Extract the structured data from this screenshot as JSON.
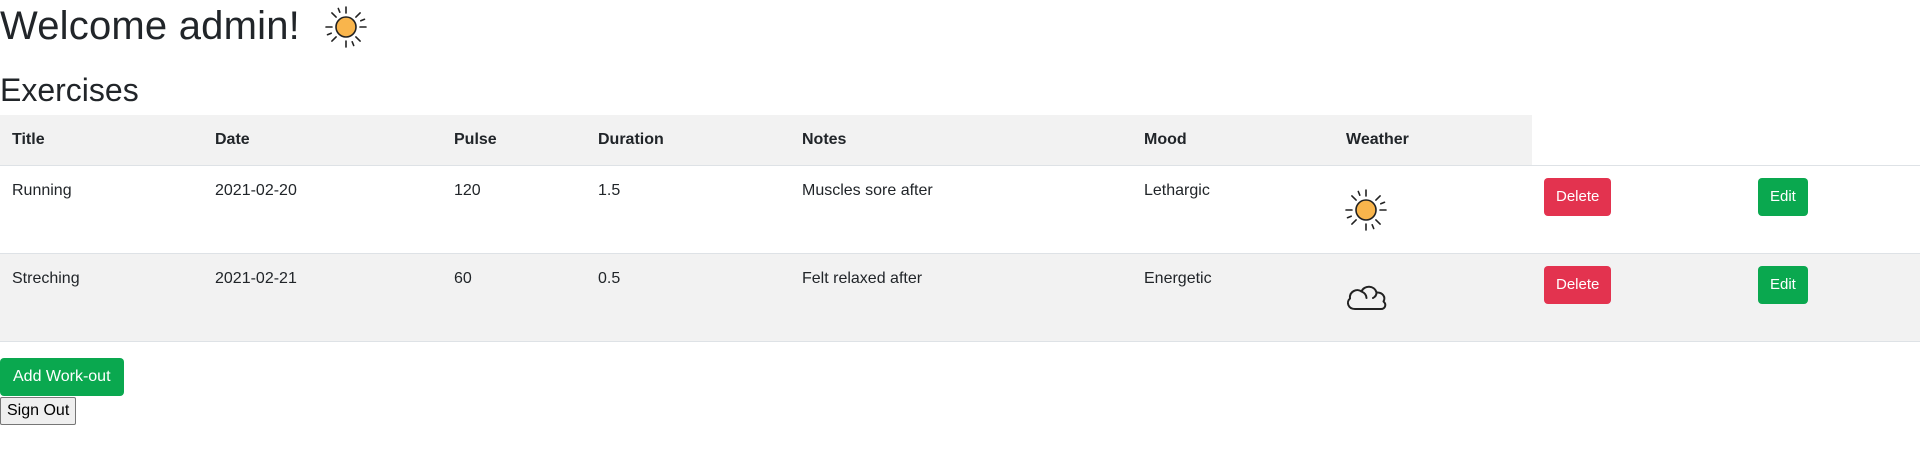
{
  "header": {
    "welcome": "Welcome admin!",
    "weather_icon": "sun-icon"
  },
  "section": {
    "title": "Exercises"
  },
  "table": {
    "columns": [
      "Title",
      "Date",
      "Pulse",
      "Duration",
      "Notes",
      "Mood",
      "Weather"
    ],
    "rows": [
      {
        "title": "Running",
        "date": "2021-02-20",
        "pulse": "120",
        "duration": "1.5",
        "notes": "Muscles sore after",
        "mood": "Lethargic",
        "weather": "sun-icon",
        "delete_label": "Delete",
        "edit_label": "Edit"
      },
      {
        "title": "Streching",
        "date": "2021-02-21",
        "pulse": "60",
        "duration": "0.5",
        "notes": "Felt relaxed after",
        "mood": "Energetic",
        "weather": "cloud-icon",
        "delete_label": "Delete",
        "edit_label": "Edit"
      }
    ]
  },
  "actions": {
    "add_label": "Add Work-out",
    "signout_label": "Sign Out"
  },
  "colors": {
    "delete": "#e3334f",
    "edit": "#0aa84f",
    "add": "#0aa84f",
    "row_stripe": "#f2f2f2",
    "sun_fill": "#f9b54c"
  }
}
